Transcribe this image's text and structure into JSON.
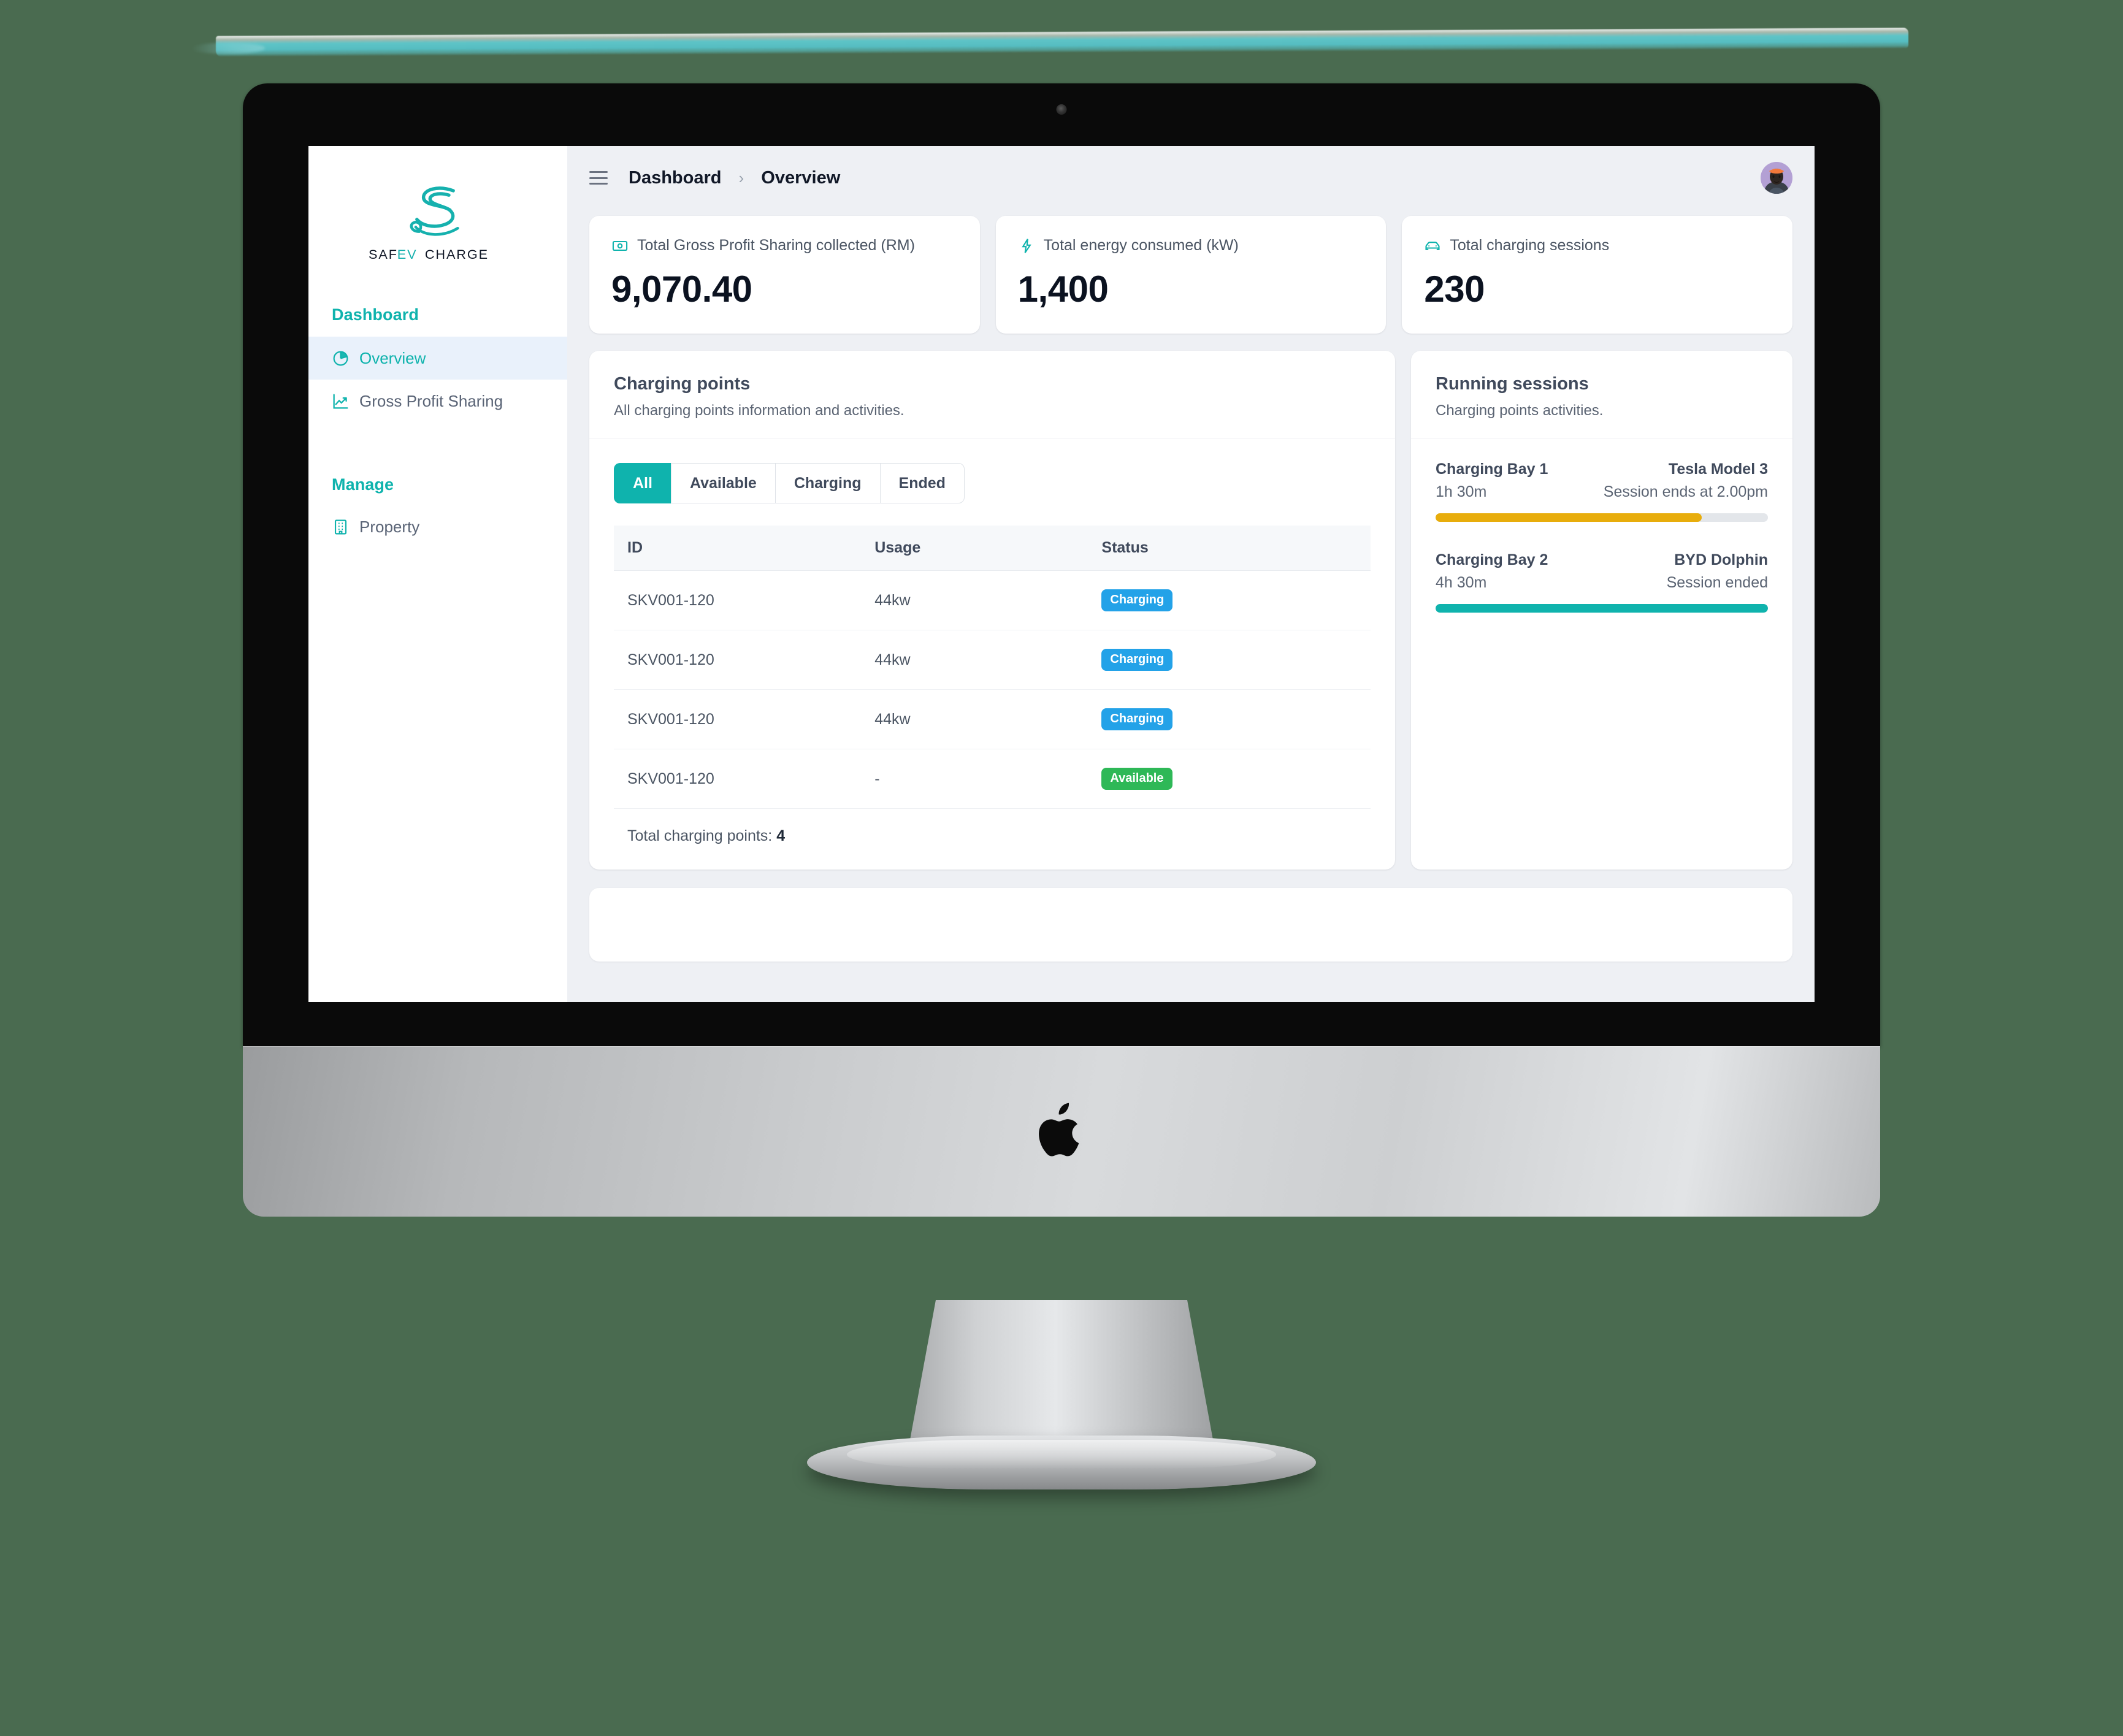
{
  "brand": {
    "name": "SAFEVCHARGE",
    "accent": "#0fb3ad"
  },
  "sidebar": {
    "groups": [
      {
        "title": "Dashboard",
        "items": [
          {
            "label": "Overview",
            "icon": "pie-chart-icon",
            "active": true
          },
          {
            "label": "Gross Profit Sharing",
            "icon": "line-chart-icon",
            "active": false
          }
        ]
      },
      {
        "title": "Manage",
        "items": [
          {
            "label": "Property",
            "icon": "building-icon",
            "active": false
          }
        ]
      }
    ]
  },
  "topbar": {
    "menu_icon": "hamburger-icon",
    "breadcrumb_root": "Dashboard",
    "breadcrumb_sep": "›",
    "breadcrumb_current": "Overview",
    "avatar_name": "user-avatar"
  },
  "stats": [
    {
      "icon": "banknote-icon",
      "label": "Total Gross Profit Sharing collected (RM)",
      "value": "9,070.40"
    },
    {
      "icon": "bolt-icon",
      "label": "Total energy consumed (kW)",
      "value": "1,400"
    },
    {
      "icon": "car-icon",
      "label": "Total charging sessions",
      "value": "230"
    }
  ],
  "charging_points": {
    "title": "Charging points",
    "subtitle": "All charging points information and activities.",
    "tabs": [
      {
        "label": "All",
        "active": true
      },
      {
        "label": "Available",
        "active": false
      },
      {
        "label": "Charging",
        "active": false
      },
      {
        "label": "Ended",
        "active": false
      }
    ],
    "columns": [
      "ID",
      "Usage",
      "Status"
    ],
    "rows": [
      {
        "id": "SKV001-120",
        "usage": "44kw",
        "status": "Charging",
        "status_kind": "charging"
      },
      {
        "id": "SKV001-120",
        "usage": "44kw",
        "status": "Charging",
        "status_kind": "charging"
      },
      {
        "id": "SKV001-120",
        "usage": "44kw",
        "status": "Charging",
        "status_kind": "charging"
      },
      {
        "id": "SKV001-120",
        "usage": "-",
        "status": "Available",
        "status_kind": "available"
      }
    ],
    "footer_label": "Total charging points:",
    "footer_count": "4",
    "status_colors": {
      "charging": "#23a2e8",
      "available": "#2eb857"
    }
  },
  "running_sessions": {
    "title": "Running sessions",
    "subtitle": "Charging points activities.",
    "sessions": [
      {
        "bay": "Charging Bay 1",
        "vehicle": "Tesla Model 3",
        "duration": "1h 30m",
        "status": "Session ends at 2.00pm",
        "progress_pct": 80,
        "progress_color": "#e8ad0c"
      },
      {
        "bay": "Charging Bay 2",
        "vehicle": "BYD Dolphin",
        "duration": "4h 30m",
        "status": "Session ended",
        "progress_pct": 100,
        "progress_color": "#0fb3ad"
      }
    ]
  }
}
